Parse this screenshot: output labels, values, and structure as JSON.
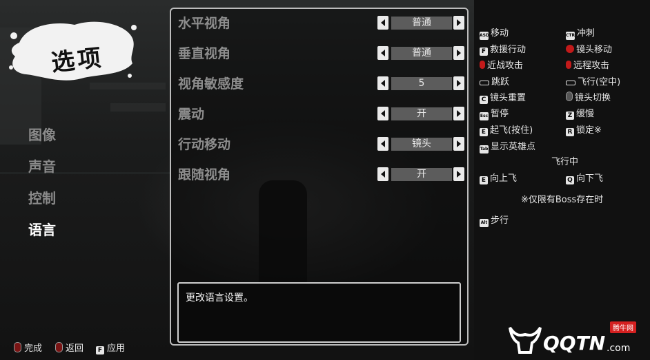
{
  "logo": {
    "title": "选项"
  },
  "menu": [
    {
      "label": "图像",
      "active": false
    },
    {
      "label": "声音",
      "active": false
    },
    {
      "label": "控制",
      "active": false
    },
    {
      "label": "语言",
      "active": true
    }
  ],
  "options": [
    {
      "label": "水平视角",
      "value": "普通"
    },
    {
      "label": "垂直视角",
      "value": "普通"
    },
    {
      "label": "视角敏感度",
      "value": "5"
    },
    {
      "label": "震动",
      "value": "开"
    },
    {
      "label": "行动移动",
      "value": "镜头"
    },
    {
      "label": "跟随视角",
      "value": "开"
    }
  ],
  "description": "更改语言设置。",
  "keys": {
    "move": "移动",
    "dash": "冲刺",
    "rescue": "救援行动",
    "camera_move": "镜头移动",
    "melee": "近战攻击",
    "ranged": "远程攻击",
    "jump": "跳跃",
    "fly": "飞行(空中)",
    "camera_reset": "镜头重置",
    "camera_switch": "镜头切换",
    "pause": "暂停",
    "slow": "缓慢",
    "takeoff": "起飞(按住)",
    "lock": "锁定※",
    "show_heroes": "显示英雄点",
    "flying_header": "飞行中",
    "fly_up": "向上飞",
    "fly_down": "向下飞",
    "boss_note": "※仅限有Boss存在时",
    "walk": "步行",
    "icons": {
      "f": "F",
      "c": "C",
      "z": "Z",
      "e": "E",
      "r": "R",
      "q": "Q",
      "esc": "Esc",
      "tab": "Tab",
      "alt": "Alt",
      "asd": "ASD",
      "ctl": "CTR"
    }
  },
  "bottom": {
    "done": "完成",
    "back": "返回",
    "apply": "应用",
    "apply_key": "F"
  },
  "watermark": {
    "brand": "QQTN",
    "com": ".com",
    "badge": "腾牛网"
  }
}
